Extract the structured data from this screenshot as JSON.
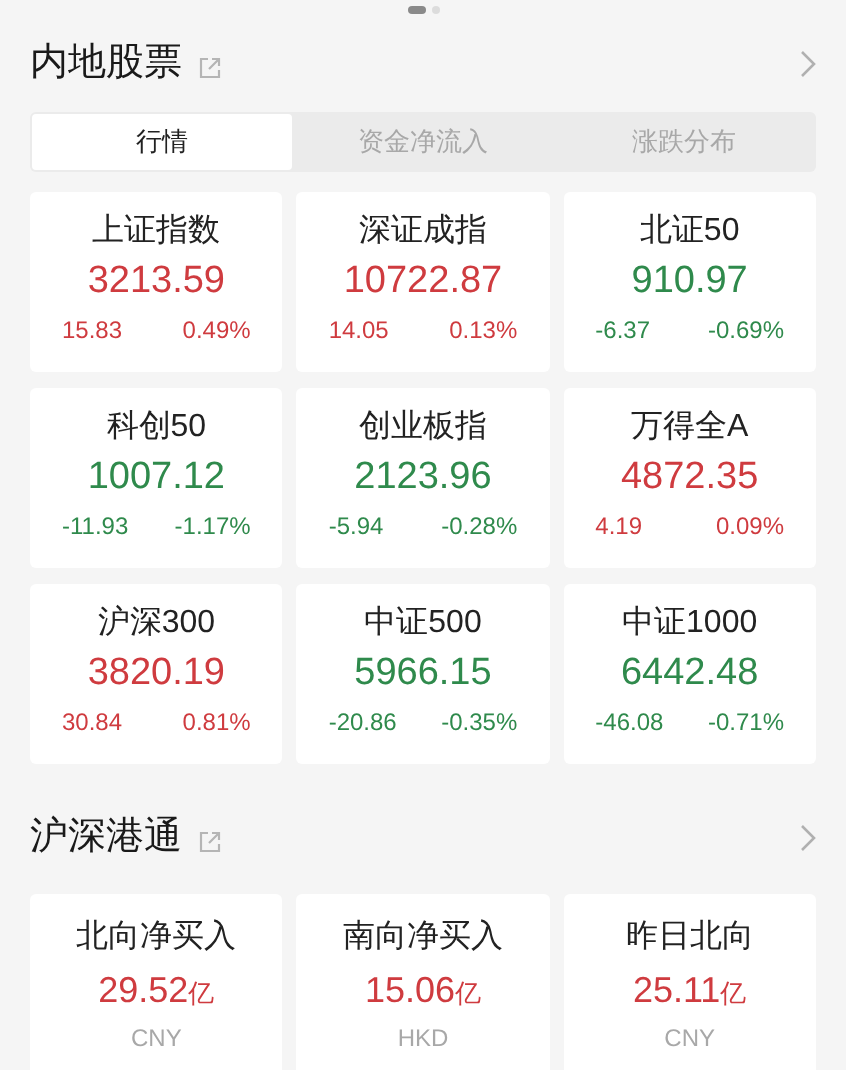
{
  "pager": [
    {
      "selected": true
    },
    {
      "selected": false
    }
  ],
  "mainland": {
    "title": "内地股票",
    "tabs": [
      {
        "label": "行情",
        "selected": true
      },
      {
        "label": "资金净流入",
        "selected": false
      },
      {
        "label": "涨跌分布",
        "selected": false
      }
    ],
    "indices": [
      {
        "name": "上证指数",
        "value": "3213.59",
        "change": "15.83",
        "percent": "0.49%",
        "color": "#cf3b3f"
      },
      {
        "name": "深证成指",
        "value": "10722.87",
        "change": "14.05",
        "percent": "0.13%",
        "color": "#cf3b3f"
      },
      {
        "name": "北证50",
        "value": "910.97",
        "change": "-6.37",
        "percent": "-0.69%",
        "color": "#2f8a4c"
      },
      {
        "name": "科创50",
        "value": "1007.12",
        "change": "-11.93",
        "percent": "-1.17%",
        "color": "#2f8a4c"
      },
      {
        "name": "创业板指",
        "value": "2123.96",
        "change": "-5.94",
        "percent": "-0.28%",
        "color": "#2f8a4c"
      },
      {
        "name": "万得全A",
        "value": "4872.35",
        "change": "4.19",
        "percent": "0.09%",
        "color": "#cf3b3f"
      },
      {
        "name": "沪深300",
        "value": "3820.19",
        "change": "30.84",
        "percent": "0.81%",
        "color": "#cf3b3f"
      },
      {
        "name": "中证500",
        "value": "5966.15",
        "change": "-20.86",
        "percent": "-0.35%",
        "color": "#2f8a4c"
      },
      {
        "name": "中证1000",
        "value": "6442.48",
        "change": "-46.08",
        "percent": "-0.71%",
        "color": "#2f8a4c"
      }
    ]
  },
  "connect": {
    "title": "沪深港通",
    "flows": [
      {
        "name": "北向净买入",
        "amount": "29.52",
        "unit": "亿",
        "currency": "CNY",
        "color": "#cf3b3f"
      },
      {
        "name": "南向净买入",
        "amount": "15.06",
        "unit": "亿",
        "currency": "HKD",
        "color": "#cf3b3f"
      },
      {
        "name": "昨日北向",
        "amount": "25.11",
        "unit": "亿",
        "currency": "CNY",
        "color": "#cf3b3f"
      }
    ]
  }
}
